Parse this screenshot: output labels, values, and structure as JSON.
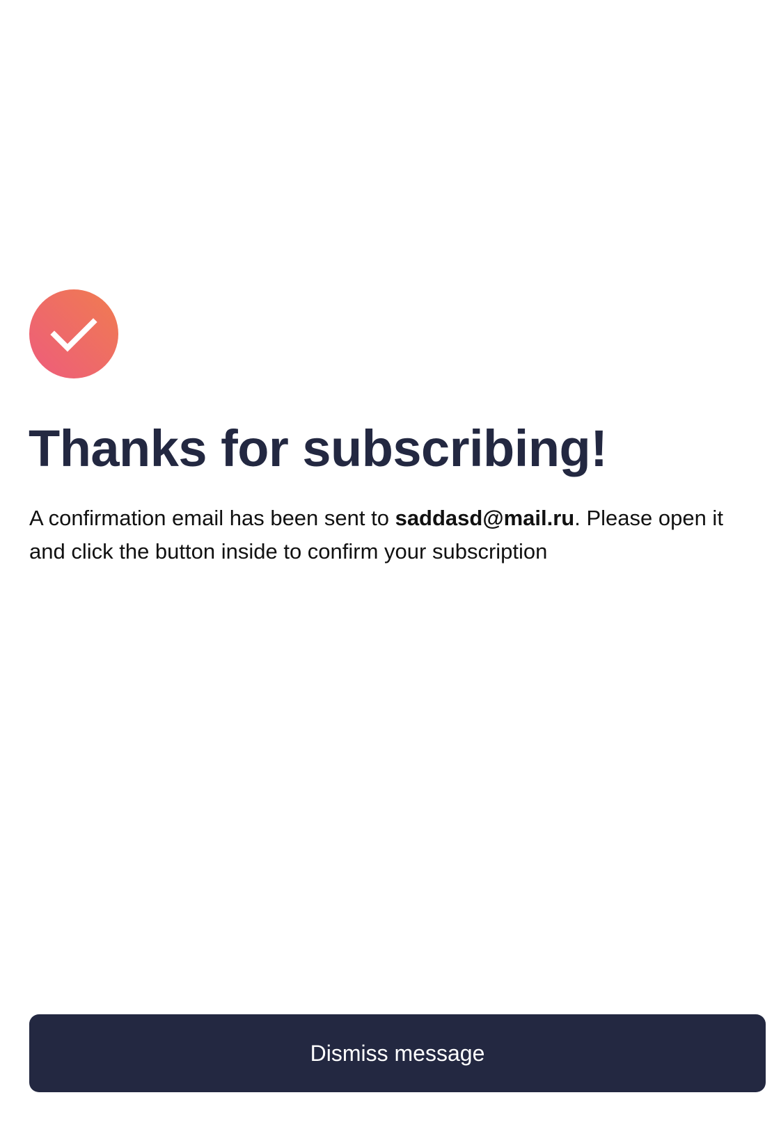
{
  "confirmation": {
    "icon": "check-circle-icon",
    "icon_gradient": [
      "#f07a55",
      "#ee5f7a"
    ],
    "title": "Thanks for subscribing!",
    "message_before": "A confirmation email has been sent to ",
    "email": "saddasd@mail.ru",
    "message_after": ". Please open it and click the button inside to confirm your subscription"
  },
  "actions": {
    "dismiss_label": "Dismiss message"
  },
  "colors": {
    "text_primary": "#232841",
    "button_background": "#232841",
    "button_text": "#ffffff",
    "background": "#ffffff"
  }
}
